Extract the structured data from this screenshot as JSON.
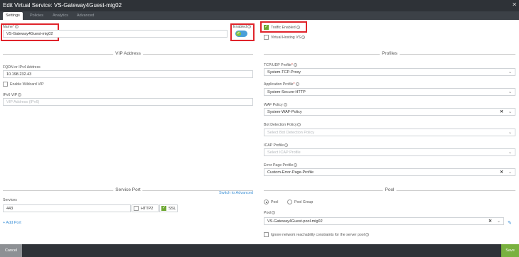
{
  "window": {
    "title": "Edit Virtual Service: VS-Gateway4Guest-mig02",
    "close": "✕"
  },
  "tabs": [
    {
      "label": "Settings"
    },
    {
      "label": "Policies"
    },
    {
      "label": "Analytics"
    },
    {
      "label": "Advanced"
    }
  ],
  "left": {
    "name": {
      "label": "Name",
      "value": "VS-Gateway4Guest-mig02"
    },
    "enabled": {
      "label": "Enabled",
      "on": true
    },
    "vip_section": "VIP Address",
    "fqdn": {
      "label": "FQDN or IPv4 Address",
      "value": "10.198.232.43"
    },
    "wildcard": {
      "label": "Enable Wildcard VIP",
      "checked": false
    },
    "ipv6": {
      "label": "IPv6 VIP",
      "placeholder": "VIP Address (IPv6)"
    },
    "service_section": "Service Port",
    "switch_advanced": "Switch to Advanced",
    "services_label": "Services",
    "port": "443",
    "http2": {
      "label": "HTTP2",
      "checked": false
    },
    "ssl": {
      "label": "SSL",
      "checked": true
    },
    "add_port": "+ Add Port"
  },
  "right": {
    "traffic_enabled": {
      "label": "Traffic Enabled",
      "checked": true
    },
    "virtual_hosting": {
      "label": "Virtual Hosting VS",
      "checked": false
    },
    "profiles_section": "Profiles",
    "tcp_udp": {
      "label": "TCP/UDP Profile",
      "value": "System-TCP-Proxy"
    },
    "app_profile": {
      "label": "Application Profile",
      "value": "System-Secure-HTTP"
    },
    "waf": {
      "label": "WAF Policy",
      "value": "System-WAF-Policy"
    },
    "bot": {
      "label": "Bot Detection Policy",
      "placeholder": "Select Bot Detection Policy"
    },
    "icap": {
      "label": "ICAP Profile",
      "placeholder": "Select ICAP Profile"
    },
    "error_page": {
      "label": "Error Page Profile",
      "value": "Custom-Error-Page-Profile"
    },
    "pool_section": "Pool",
    "pool_radio": {
      "label": "Pool",
      "selected": true
    },
    "pool_group_radio": {
      "label": "Pool Group",
      "selected": false
    },
    "pool": {
      "label": "Pool",
      "value": "VS-Gateway4Guest-pool-mig02"
    },
    "ignore_reach": {
      "label": "Ignore network reachability constraints for the server pool",
      "checked": false
    }
  },
  "footer": {
    "cancel": "Cancel",
    "save": "Save"
  },
  "colors": {
    "titlebar": "#2e3237",
    "highlight": "#e0242b",
    "save": "#79b13f",
    "link": "#3a8fd6"
  }
}
